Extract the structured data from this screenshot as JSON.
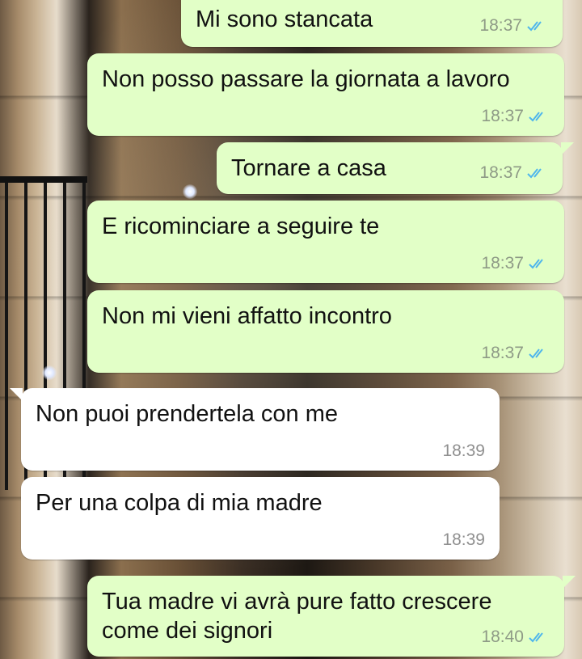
{
  "conversation": {
    "messages": [
      {
        "text": "Mi sono stancata",
        "time": "18:37",
        "direction": "outgoing",
        "read": true
      },
      {
        "text": "Non posso passare la giornata a lavoro",
        "time": "18:37",
        "direction": "outgoing",
        "read": true
      },
      {
        "text": "Tornare a casa",
        "time": "18:37",
        "direction": "outgoing",
        "read": true
      },
      {
        "text": "E ricominciare a seguire te",
        "time": "18:37",
        "direction": "outgoing",
        "read": true
      },
      {
        "text": "Non mi vieni affatto incontro",
        "time": "18:37",
        "direction": "outgoing",
        "read": true
      },
      {
        "text": "Non puoi prendertela con me",
        "time": "18:39",
        "direction": "incoming"
      },
      {
        "text": "Per una colpa di mia madre",
        "time": "18:39",
        "direction": "incoming"
      },
      {
        "text": "Tua madre vi avrà pure fatto crescere\ncome dei signori",
        "time": "18:40",
        "direction": "outgoing",
        "read": true
      }
    ]
  },
  "colors": {
    "outgoing_bubble": "#e2ffc7",
    "incoming_bubble": "#ffffff",
    "read_ticks": "#4fb6ec"
  },
  "icons": {
    "read_receipt": "double-check-icon"
  }
}
